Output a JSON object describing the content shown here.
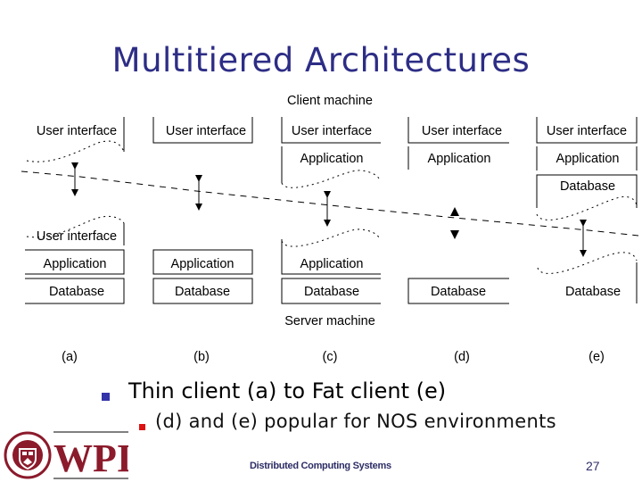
{
  "slide": {
    "title": "Multitiered Architectures",
    "bullets": [
      {
        "level": 1,
        "text": "Thin client (a) to Fat client (e)",
        "bullet_color": "#3333aa"
      },
      {
        "level": 2,
        "text": "(d) and (e) popular for NOS environments",
        "bullet_color": "#dd1111"
      }
    ],
    "footer": "Distributed Computing Systems",
    "page_number": "27",
    "logo": {
      "text": "WPI",
      "seal_year": "1865",
      "color": "#8b1a2b"
    }
  },
  "diagram": {
    "client_label": "Client machine",
    "server_label": "Server machine",
    "tiers": {
      "ui": "User interface",
      "app": "Application",
      "db": "Database"
    },
    "configurations": [
      {
        "label": "(a)",
        "client": [
          "User interface"
        ],
        "server": [
          "User interface",
          "Application",
          "Database"
        ]
      },
      {
        "label": "(b)",
        "client": [
          "User interface"
        ],
        "server": [
          "Application",
          "Database"
        ]
      },
      {
        "label": "(c)",
        "client": [
          "User interface",
          "Application"
        ],
        "server": [
          "Application",
          "Database"
        ]
      },
      {
        "label": "(d)",
        "client": [
          "User interface",
          "Application"
        ],
        "server": [
          "Database"
        ]
      },
      {
        "label": "(e)",
        "client": [
          "User interface",
          "Application",
          "Database"
        ],
        "server": [
          "Database"
        ]
      }
    ]
  }
}
